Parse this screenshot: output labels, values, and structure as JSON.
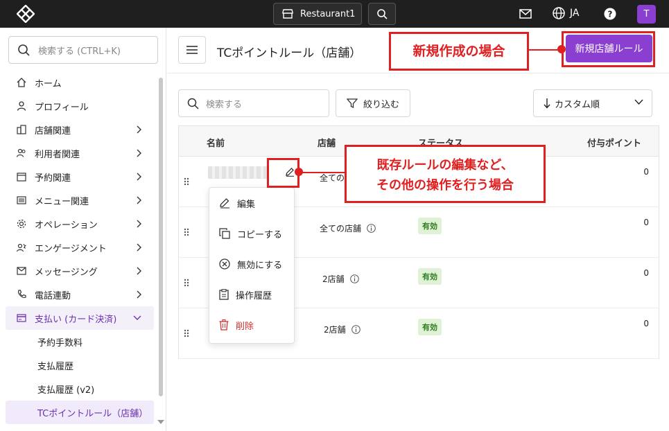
{
  "topbar": {
    "store_label": "Restaurant1",
    "language": "JA",
    "avatar_initial": "T"
  },
  "sidebar": {
    "search_placeholder": "検索する (CTRL+K)",
    "items": [
      {
        "label": "ホーム",
        "icon": "home-icon"
      },
      {
        "label": "プロフィール",
        "icon": "person-icon"
      },
      {
        "label": "店舗関連",
        "icon": "building-icon"
      },
      {
        "label": "利用者関連",
        "icon": "users-icon"
      },
      {
        "label": "予約関連",
        "icon": "calendar-icon"
      },
      {
        "label": "メニュー関連",
        "icon": "menu-list-icon"
      },
      {
        "label": "オペレーション",
        "icon": "gear-icon"
      },
      {
        "label": "エンゲージメント",
        "icon": "engagement-icon"
      },
      {
        "label": "メッセージング",
        "icon": "mail-icon"
      },
      {
        "label": "電話連動",
        "icon": "phone-icon"
      },
      {
        "label": "支払い (カード決済)",
        "icon": "card-icon"
      }
    ],
    "sub_items": [
      "予約手数料",
      "支払履歴",
      "支払履歴 (v2)",
      "TCポイントルール（店舗）"
    ]
  },
  "header": {
    "title": "TCポイントルール（店舗）",
    "new_button": "新規店舗ルール"
  },
  "toolbar": {
    "search_placeholder": "検索する",
    "filter_label": "絞り込む",
    "sort_label": "カスタム順"
  },
  "table": {
    "columns": [
      "名前",
      "店舗",
      "ステータス",
      "付与ポイント"
    ],
    "rows": [
      {
        "store": "全ての",
        "status": "",
        "points": "0"
      },
      {
        "store": "全ての店舗",
        "status": "有効",
        "points": "0"
      },
      {
        "store": "2店舗",
        "status": "有効",
        "points": "0"
      },
      {
        "store": "2店舗",
        "status": "有効",
        "points": "0"
      }
    ]
  },
  "dropdown": {
    "items": [
      "編集",
      "コピーする",
      "無効にする",
      "操作履歴",
      "削除"
    ]
  },
  "annotations": {
    "callout_new": "新規作成の場合",
    "callout_edit_line1": "既存ルールの編集など、",
    "callout_edit_line2": "その他の操作を行う場合"
  },
  "colors": {
    "accent": "#8a3fd1",
    "callout_red": "#e02020",
    "badge_green": "#2f7d23"
  }
}
